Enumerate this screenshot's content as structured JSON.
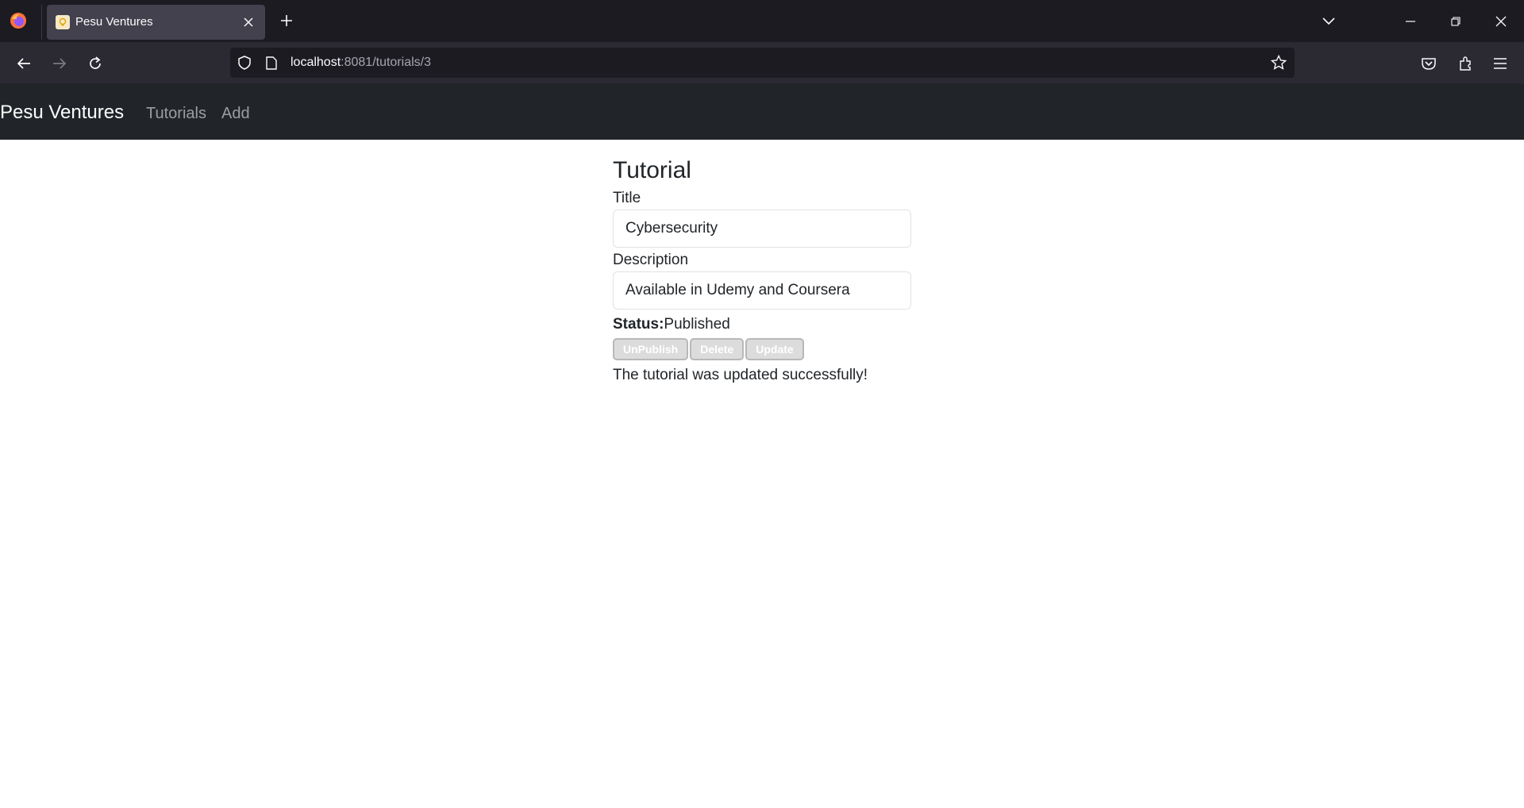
{
  "browser": {
    "tab_title": "Pesu Ventures",
    "url_host": "localhost",
    "url_rest": ":8081/tutorials/3"
  },
  "app": {
    "brand": "Pesu Ventures",
    "nav": [
      "Tutorials",
      "Add"
    ]
  },
  "tutorial": {
    "heading": "Tutorial",
    "title_label": "Title",
    "title_value": "Cybersecurity",
    "description_label": "Description",
    "description_value": "Available in Udemy and Coursera",
    "status_label": "Status:",
    "status_value": "Published",
    "buttons": {
      "unpublish": "UnPublish",
      "delete": "Delete",
      "update": "Update"
    },
    "message": "The tutorial was updated successfully!"
  },
  "colors": {
    "chrome_dark": "#1c1b22",
    "chrome_toolbar": "#2b2a33",
    "app_navbar": "#212529"
  }
}
